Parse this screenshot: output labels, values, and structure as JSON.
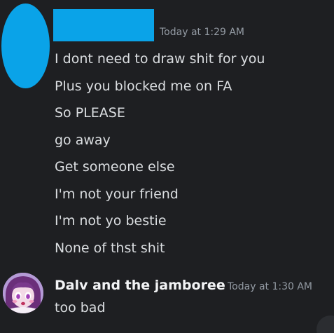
{
  "message1": {
    "timestamp": "Today at 1:29 AM",
    "lines": [
      "I dont need to draw shit for you",
      "Plus you blocked me on FA",
      "So PLEASE",
      "go away",
      "Get someone else",
      "I'm not your friend",
      "I'm not yo bestie",
      "None of thst shit"
    ]
  },
  "message2": {
    "username": "Dalv and the jamboree",
    "timestamp": "Today at 1:30 AM",
    "text": "too bad"
  },
  "colors": {
    "background": "#1e1f22",
    "redaction": "#0aa3e8",
    "text": "#dbdee1",
    "muted": "#949ba4",
    "username": "#f2f3f5"
  }
}
